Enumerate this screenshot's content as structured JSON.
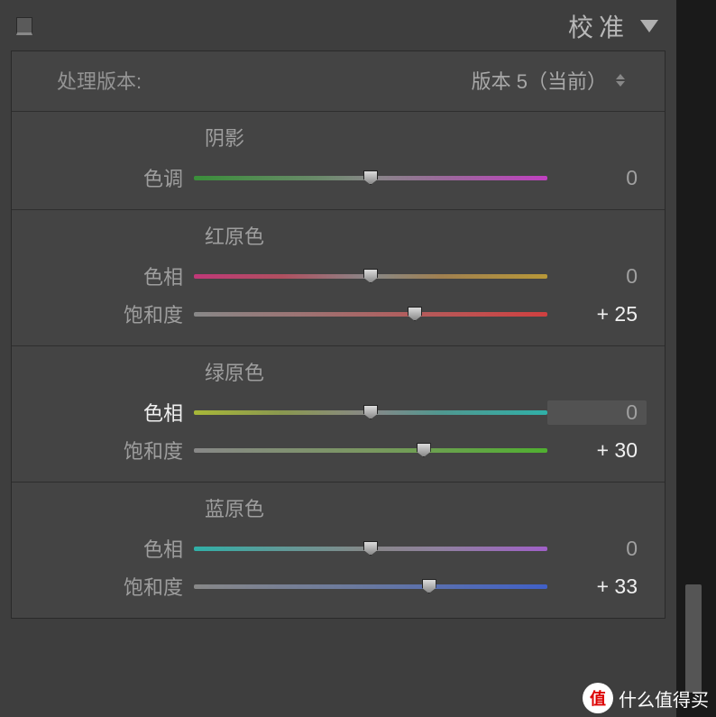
{
  "header": {
    "title": "校准"
  },
  "version": {
    "label": "处理版本:",
    "value": "版本 5（当前）"
  },
  "sections": {
    "shadows": {
      "title": "阴影",
      "sliders": {
        "tint": {
          "label": "色调",
          "value": "0",
          "position": 50
        }
      }
    },
    "red": {
      "title": "红原色",
      "sliders": {
        "hue": {
          "label": "色相",
          "value": "0",
          "position": 50
        },
        "saturation": {
          "label": "饱和度",
          "value": "+ 25",
          "position": 62.5
        }
      }
    },
    "green": {
      "title": "绿原色",
      "sliders": {
        "hue": {
          "label": "色相",
          "value": "0",
          "position": 50
        },
        "saturation": {
          "label": "饱和度",
          "value": "+ 30",
          "position": 65
        }
      }
    },
    "blue": {
      "title": "蓝原色",
      "sliders": {
        "hue": {
          "label": "色相",
          "value": "0",
          "position": 50
        },
        "saturation": {
          "label": "饱和度",
          "value": "+ 33",
          "position": 66.5
        }
      }
    }
  },
  "watermark": {
    "badge": "值",
    "text": "什么值得买"
  }
}
